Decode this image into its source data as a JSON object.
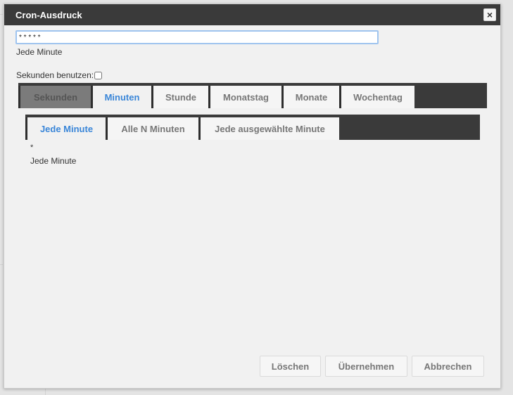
{
  "dialog": {
    "title": "Cron-Ausdruck",
    "close_icon": "close-icon",
    "close_glyph": "×"
  },
  "expression": {
    "value": "* * * * *",
    "description": "Jede Minute"
  },
  "seconds_option": {
    "label": "Sekunden benutzen:",
    "checked": false
  },
  "main_tabs": [
    {
      "label": "Sekunden",
      "state": "disabled"
    },
    {
      "label": "Minuten",
      "state": "active"
    },
    {
      "label": "Stunde",
      "state": "normal"
    },
    {
      "label": "Monatstag",
      "state": "normal"
    },
    {
      "label": "Monate",
      "state": "normal"
    },
    {
      "label": "Wochentag",
      "state": "normal"
    }
  ],
  "minute_tabs": [
    {
      "label": "Jede Minute",
      "state": "active"
    },
    {
      "label": "Alle N Minuten",
      "state": "normal"
    },
    {
      "label": "Jede ausgewählte Minute",
      "state": "normal"
    }
  ],
  "panel": {
    "value": "*",
    "description": "Jede Minute"
  },
  "buttons": {
    "clear": "Löschen",
    "apply": "Übernehmen",
    "cancel": "Abbrechen"
  },
  "colors": {
    "titlebar": "#3a3a3a",
    "accent": "#3a86d8",
    "disabled_tab": "#7b7b7b"
  }
}
